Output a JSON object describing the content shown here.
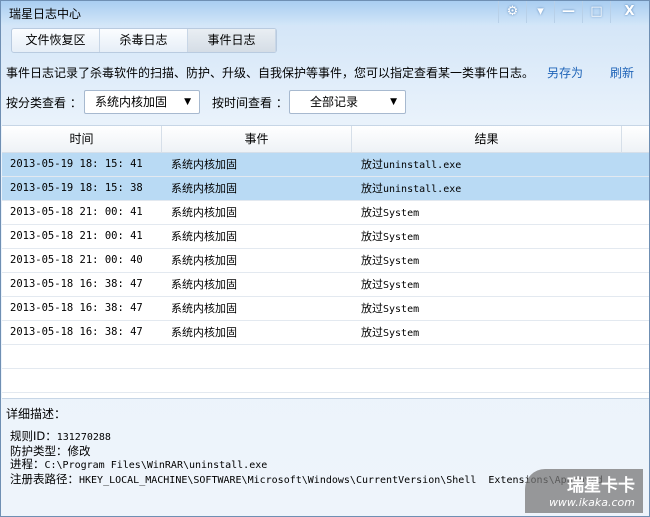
{
  "window": {
    "title": "瑞星日志中心",
    "buttons": [
      "⚙",
      "▾",
      "—",
      "□",
      "X"
    ]
  },
  "tabs": [
    {
      "label": "文件恢复区"
    },
    {
      "label": "杀毒日志"
    },
    {
      "label": "事件日志"
    }
  ],
  "description": "事件日志记录了杀毒软件的扫描、防护、升级、自我保护等事件，您可以指定查看某一类事件日志。",
  "actions": {
    "save_as": "另存为",
    "refresh": "刷新"
  },
  "filters": {
    "category_label": "按分类查看 ：",
    "category_value": "系统内核加固",
    "time_label": "按时间查看 ：",
    "time_value": "全部记录"
  },
  "table": {
    "headers": [
      "时间",
      "事件",
      "结果"
    ],
    "rows": [
      {
        "time": "2013-05-19 18: 15: 41",
        "event": "系统内核加固",
        "result_prefix": "放过",
        "result": "uninstall.exe",
        "selected": true
      },
      {
        "time": "2013-05-19 18: 15: 38",
        "event": "系统内核加固",
        "result_prefix": "放过",
        "result": "uninstall.exe",
        "selected": true
      },
      {
        "time": "2013-05-18 21: 00: 41",
        "event": "系统内核加固",
        "result_prefix": "放过",
        "result": "System"
      },
      {
        "time": "2013-05-18 21: 00: 41",
        "event": "系统内核加固",
        "result_prefix": "放过",
        "result": "System"
      },
      {
        "time": "2013-05-18 21: 00: 40",
        "event": "系统内核加固",
        "result_prefix": "放过",
        "result": "System"
      },
      {
        "time": "2013-05-18 16: 38: 47",
        "event": "系统内核加固",
        "result_prefix": "放过",
        "result": "System"
      },
      {
        "time": "2013-05-18 16: 38: 47",
        "event": "系统内核加固",
        "result_prefix": "放过",
        "result": "System"
      },
      {
        "time": "2013-05-18 16: 38: 47",
        "event": "系统内核加固",
        "result_prefix": "放过",
        "result": "System"
      }
    ]
  },
  "detail": {
    "title": "详细描述：",
    "lines": [
      {
        "label": "规则ID：",
        "value": "131270288"
      },
      {
        "label": "防护类型：",
        "value": "修改"
      },
      {
        "label": "进程：",
        "value": "C:\\Program Files\\WinRAR\\uninstall.exe"
      },
      {
        "label": "注册表路径：",
        "value": "HKEY_LOCAL_MACHINE\\SOFTWARE\\Microsoft\\Windows\\CurrentVersion\\Shell  Extensions\\Approved"
      }
    ]
  },
  "watermark": {
    "brand": "瑞星卡卡",
    "url": "www.ikaka.com"
  }
}
